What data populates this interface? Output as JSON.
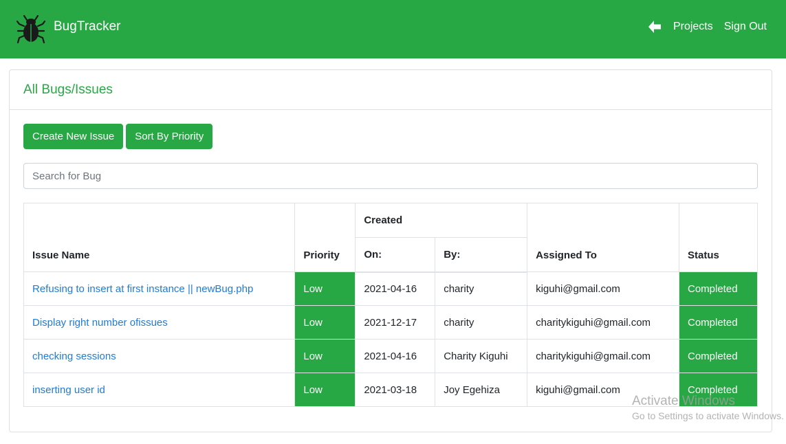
{
  "navbar": {
    "brand": "BugTracker",
    "brand_icon": "bug-icon",
    "back_icon": "arrow-left-icon",
    "links": [
      "Projects",
      "Sign Out"
    ],
    "color": "#28a745"
  },
  "card": {
    "title": "All Bugs/Issues",
    "buttons": {
      "create": "Create New Issue",
      "sort": "Sort By Priority"
    },
    "search_placeholder": "Search for Bug"
  },
  "table": {
    "headers": {
      "issue_name": "Issue Name",
      "priority": "Priority",
      "created": "Created",
      "on": "On:",
      "by": "By:",
      "assigned_to": "Assigned To",
      "status": "Status"
    },
    "rows": [
      {
        "issue": "Refusing to insert at first instance || newBug.php",
        "priority": "Low",
        "on": "2021-04-16",
        "by": "charity",
        "assigned": "kiguhi@gmail.com",
        "status": "Completed"
      },
      {
        "issue": "Display right number ofissues",
        "priority": "Low",
        "on": "2021-12-17",
        "by": "charity",
        "assigned": "charitykiguhi@gmail.com",
        "status": "Completed"
      },
      {
        "issue": "checking sessions",
        "priority": "Low",
        "on": "2021-04-16",
        "by": "Charity Kiguhi",
        "assigned": "charitykiguhi@gmail.com",
        "status": "Completed"
      },
      {
        "issue": "inserting user id",
        "priority": "Low",
        "on": "2021-03-18",
        "by": "Joy Egehiza",
        "assigned": "kiguhi@gmail.com",
        "status": "Completed"
      }
    ]
  },
  "watermark": {
    "line1": "Activate Windows",
    "line2": "Go to Settings to activate Windows."
  }
}
